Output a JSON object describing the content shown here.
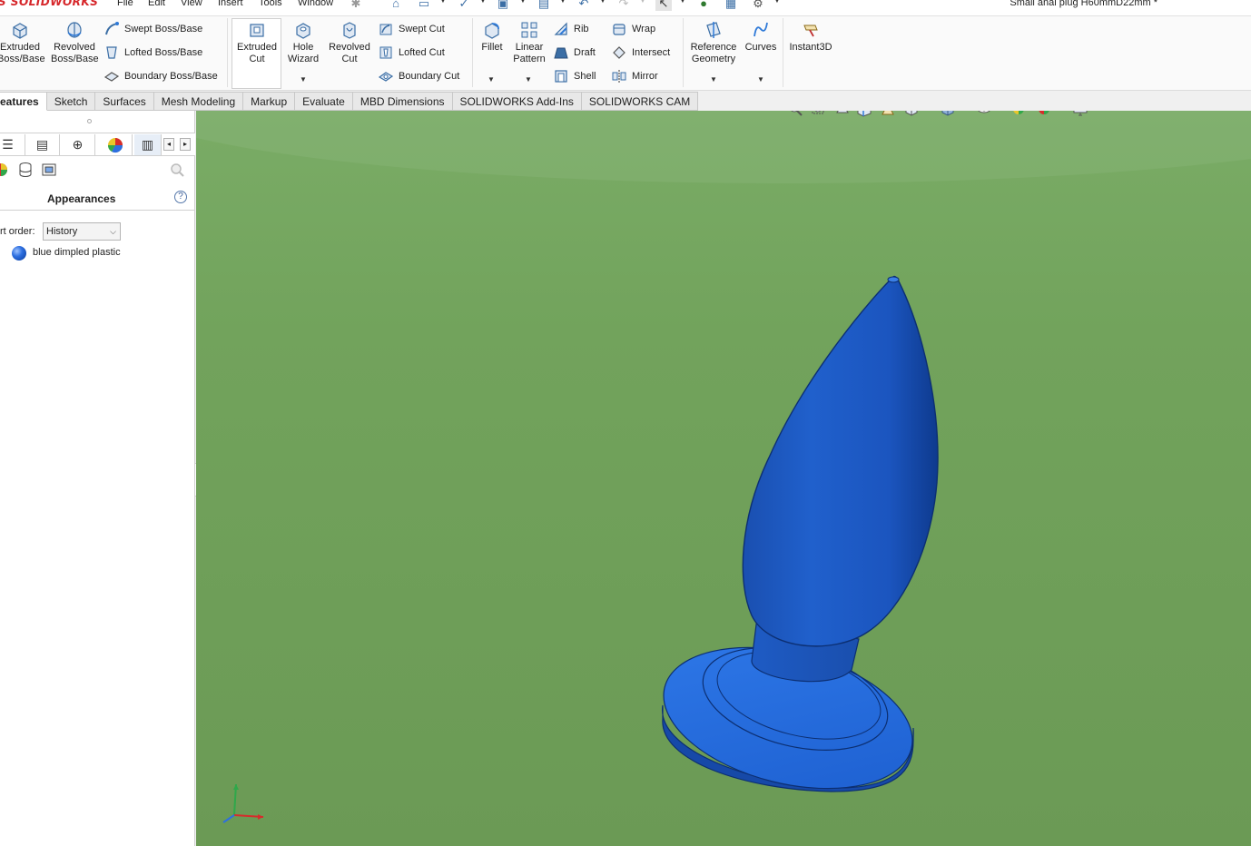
{
  "app": {
    "logo": "S SOLIDWORKS",
    "document_title": "Small anal plug  H60mmD22mm *"
  },
  "menu": [
    "File",
    "Edit",
    "View",
    "Insert",
    "Tools",
    "Window"
  ],
  "ribbon": {
    "extruded_boss": "Extruded\nBoss/Base",
    "revolved_boss": "Revolved\nBoss/Base",
    "swept_boss": "Swept Boss/Base",
    "lofted_boss": "Lofted Boss/Base",
    "boundary_boss": "Boundary Boss/Base",
    "extruded_cut": "Extruded\nCut",
    "hole_wizard": "Hole\nWizard",
    "revolved_cut": "Revolved\nCut",
    "swept_cut": "Swept Cut",
    "lofted_cut": "Lofted Cut",
    "boundary_cut": "Boundary Cut",
    "fillet": "Fillet",
    "linear_pattern": "Linear\nPattern",
    "rib": "Rib",
    "draft": "Draft",
    "shell": "Shell",
    "wrap": "Wrap",
    "intersect": "Intersect",
    "mirror": "Mirror",
    "reference_geometry": "Reference\nGeometry",
    "curves": "Curves",
    "instant3d": "Instant3D"
  },
  "tabs": [
    {
      "label": "eatures",
      "active": true
    },
    {
      "label": "Sketch"
    },
    {
      "label": "Surfaces"
    },
    {
      "label": "Mesh Modeling"
    },
    {
      "label": "Markup"
    },
    {
      "label": "Evaluate"
    },
    {
      "label": "MBD Dimensions"
    },
    {
      "label": "SOLIDWORKS Add-Ins"
    },
    {
      "label": "SOLIDWORKS CAM"
    }
  ],
  "appearances_panel": {
    "title": "Appearances",
    "sort_label": "rt order:",
    "sort_value": "History",
    "items": [
      {
        "label": "blue dimpled plastic",
        "color": "#2d6fe0"
      }
    ]
  },
  "colors": {
    "viewport_green": "#72a35c",
    "model_blue": "#1f63d0",
    "logo_red": "#d6262a"
  },
  "icons": {
    "help": "?"
  }
}
